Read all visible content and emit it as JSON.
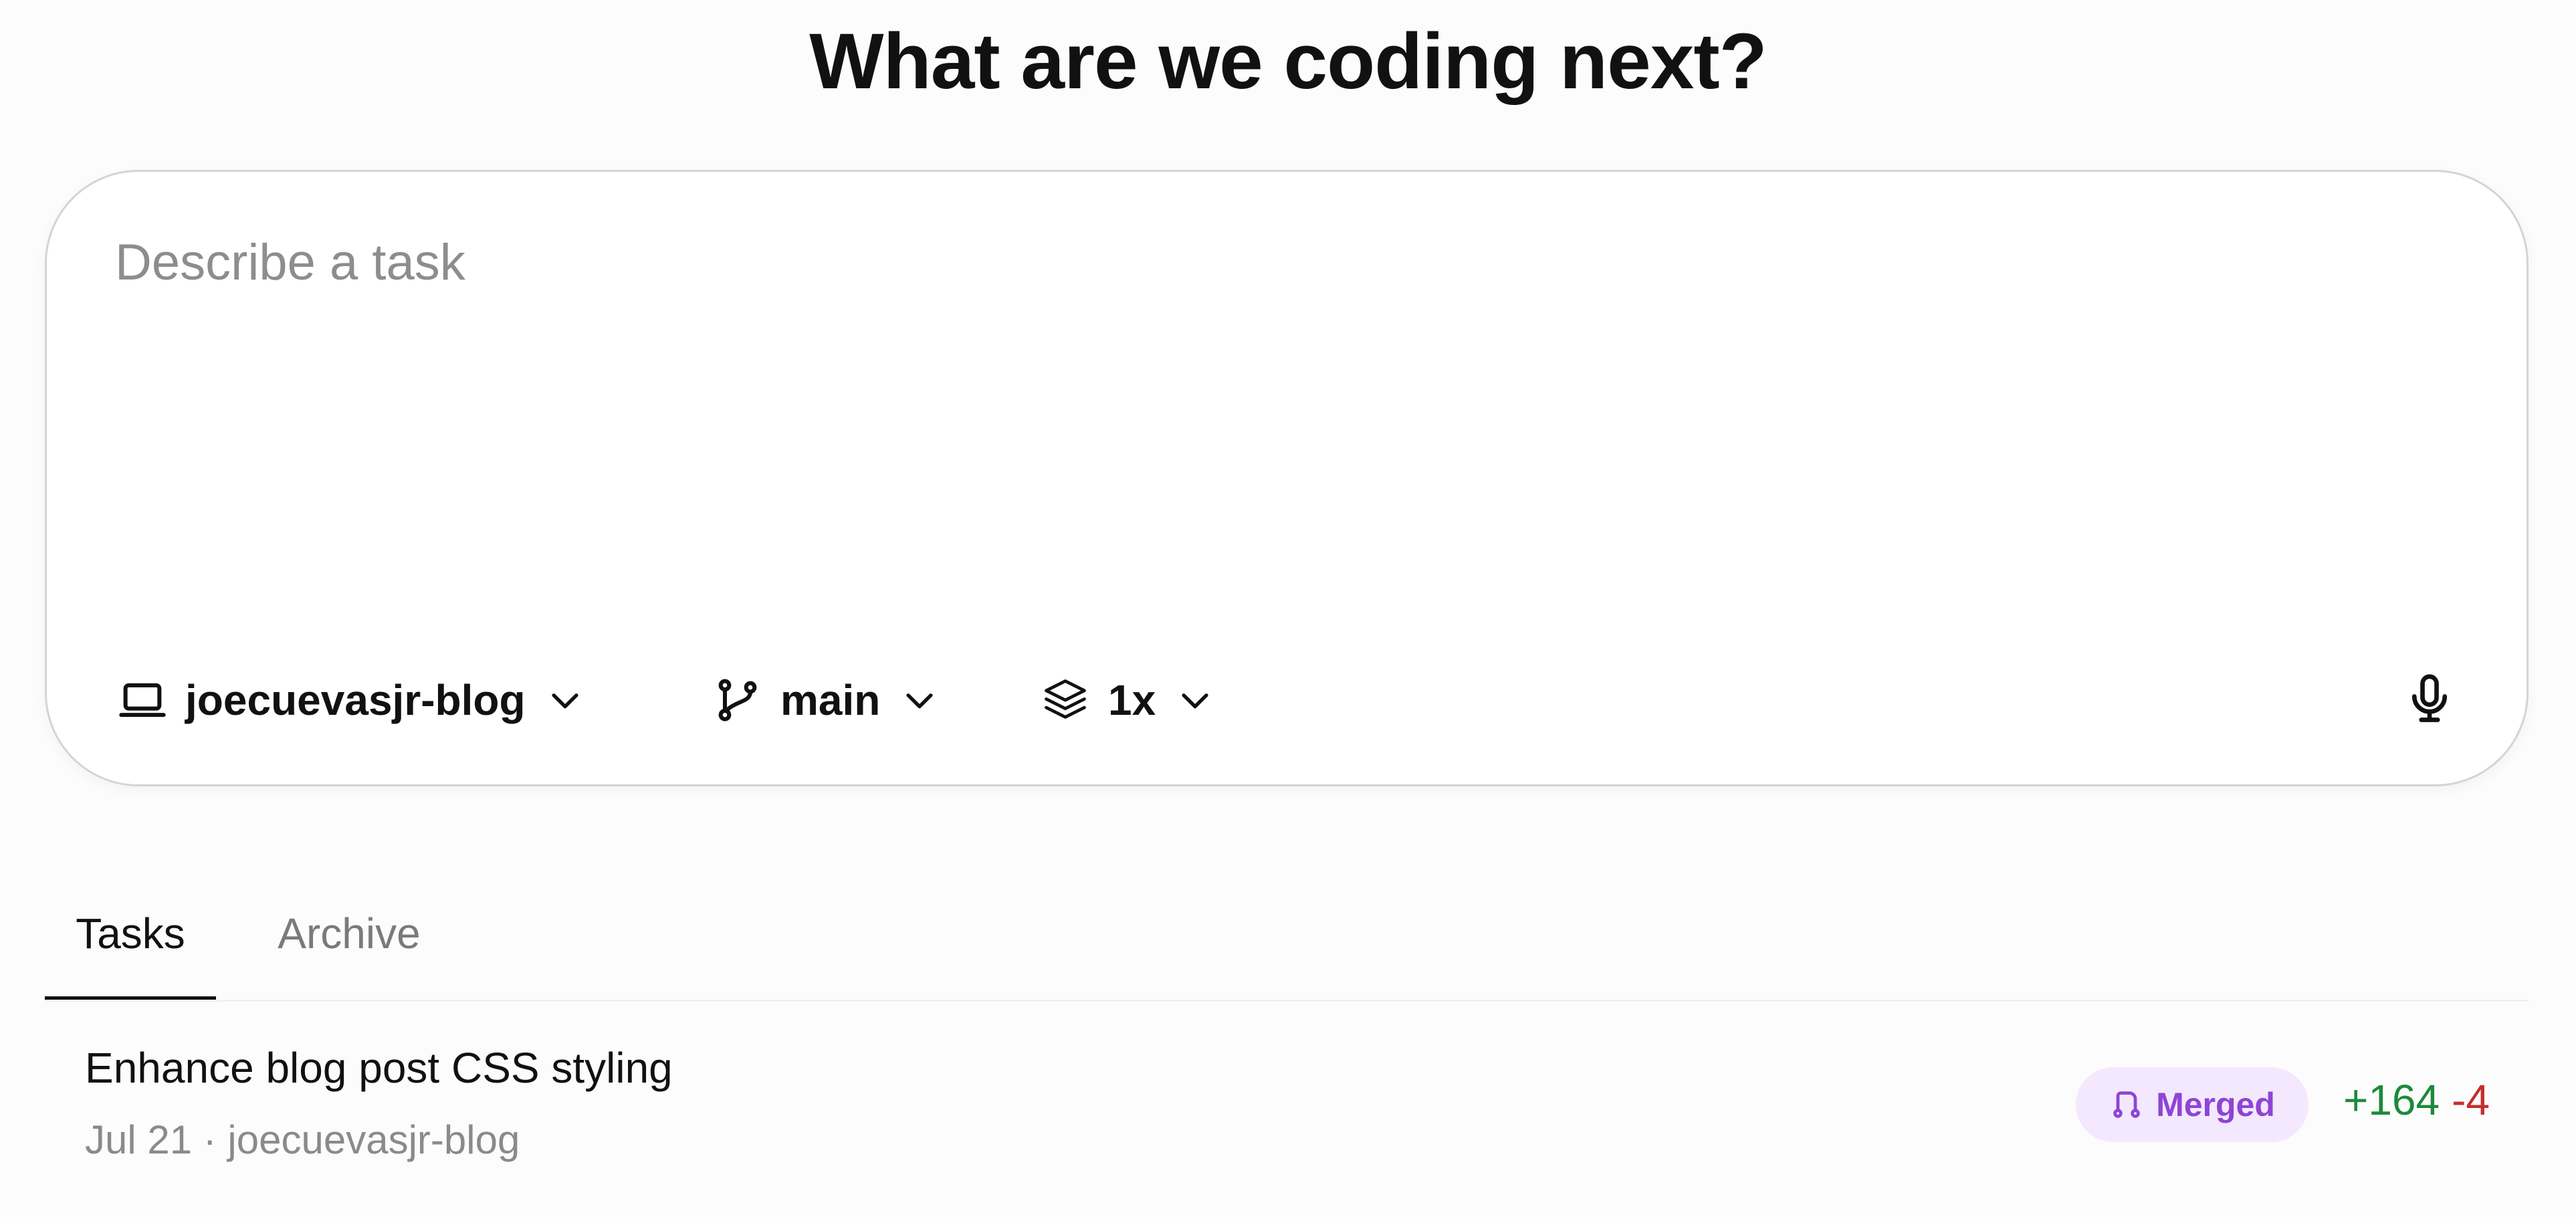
{
  "heading": "What are we coding next?",
  "composer": {
    "placeholder": "Describe a task",
    "value": ""
  },
  "toolbar": {
    "repo": {
      "label": "joecuevasjr-blog",
      "icon": "laptop-icon"
    },
    "branch": {
      "label": "main",
      "icon": "git-branch-icon"
    },
    "multiplier": {
      "label": "1x",
      "icon": "layers-icon"
    },
    "mic": {
      "icon": "microphone-icon"
    }
  },
  "tabs": [
    {
      "label": "Tasks",
      "active": true
    },
    {
      "label": "Archive",
      "active": false
    }
  ],
  "tasks": [
    {
      "title": "Enhance blog post CSS styling",
      "meta": "Jul 21 · joecuevasjr-blog",
      "status": "Merged",
      "additions": "+164",
      "deletions": "-4"
    }
  ],
  "colors": {
    "merged_badge_bg": "#f3e8fd",
    "merged_badge_text": "#8e44d6",
    "additions": "#1c8a3a",
    "deletions": "#c22f2f"
  }
}
